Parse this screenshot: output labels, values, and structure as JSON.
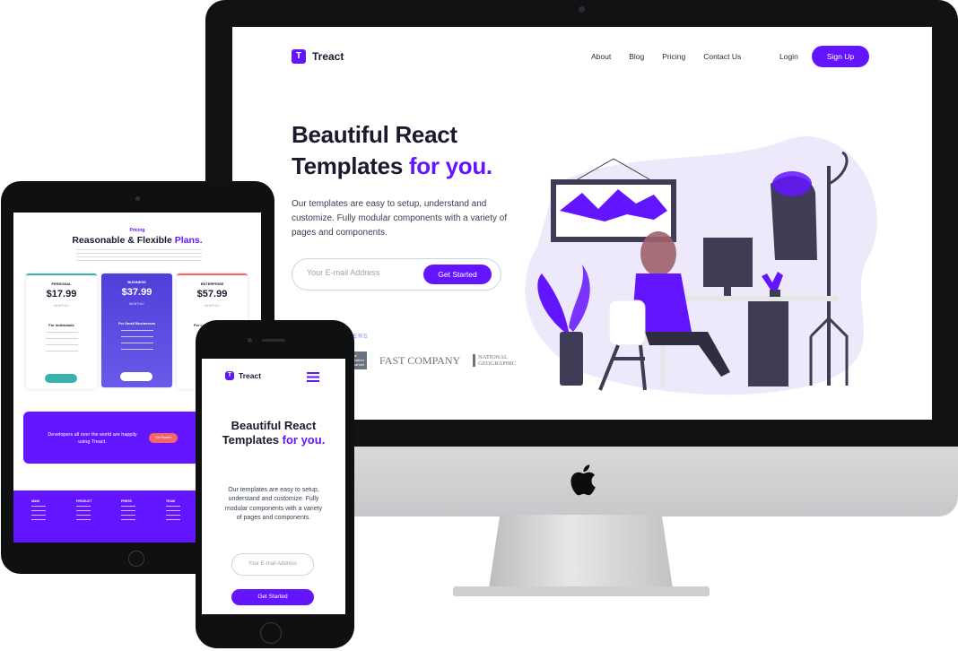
{
  "desktop": {
    "brand": "Treact",
    "brand_initial": "T",
    "nav": [
      "About",
      "Blog",
      "Pricing",
      "Contact Us"
    ],
    "login_label": "Login",
    "signup_label": "Sign Up",
    "heading_line1": "Beautiful React",
    "heading_line2": "Templates ",
    "heading_accent": "for you.",
    "paragraph": "Our templates are easy to setup, understand and customize. Fully modular components with a variety of pages and components.",
    "email_placeholder": "Your E-mail Address",
    "cta_label": "Get Started",
    "customers_label": "TOMERS",
    "customer_logos": [
      "The Weather Channel",
      "FAST COMPANY",
      "NATIONAL GEOGRAPHIC"
    ],
    "colors": {
      "accent": "#6415ff"
    }
  },
  "tablet": {
    "subheading": "Pricing",
    "heading": "Reasonable & Flexible ",
    "heading_accent": "Plans.",
    "plans": [
      {
        "name": "PERSONAL",
        "price": "$17.99",
        "audience": "For Individuals",
        "accent": "#38b2ac"
      },
      {
        "name": "BUSINESS",
        "price": "$37.99",
        "audience": "For Small Businesses",
        "accent": "#ffffff"
      },
      {
        "name": "ENTERPRISE",
        "price": "$57.99",
        "audience": "For Large Companies",
        "accent": "#f56565"
      }
    ],
    "cta_text": "Developers all over the world are happily using Treact.",
    "cta_button": "Get Started",
    "footer_columns": [
      "MAIN",
      "PRODUCT",
      "PRESS",
      "TEAM"
    ]
  },
  "mobile": {
    "brand": "Treact",
    "brand_initial": "T",
    "heading": "Beautiful React Templates ",
    "heading_accent": "for you.",
    "paragraph": "Our templates are easy to setup, understand and customize. Fully modular components with a variety of pages and components.",
    "email_placeholder": "Your E-mail Address",
    "cta_label": "Get Started",
    "menu_icon": "hamburger-icon"
  }
}
